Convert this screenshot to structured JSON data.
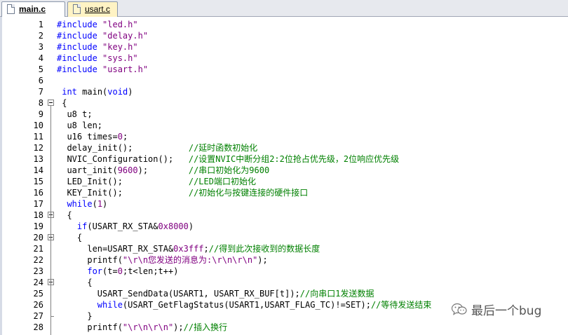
{
  "tabs": [
    {
      "label": "main.c",
      "active": true
    },
    {
      "label": "usart.c",
      "active": false
    }
  ],
  "lines": [
    {
      "n": "1",
      "tokens": [
        {
          "t": "#include ",
          "c": "kw"
        },
        {
          "t": "\"led.h\"",
          "c": "str"
        }
      ]
    },
    {
      "n": "2",
      "tokens": [
        {
          "t": "#include ",
          "c": "kw"
        },
        {
          "t": "\"delay.h\"",
          "c": "str"
        }
      ]
    },
    {
      "n": "3",
      "tokens": [
        {
          "t": "#include ",
          "c": "kw"
        },
        {
          "t": "\"key.h\"",
          "c": "str"
        }
      ]
    },
    {
      "n": "4",
      "tokens": [
        {
          "t": "#include ",
          "c": "kw"
        },
        {
          "t": "\"sys.h\"",
          "c": "str"
        }
      ]
    },
    {
      "n": "5",
      "tokens": [
        {
          "t": "#include ",
          "c": "kw"
        },
        {
          "t": "\"usart.h\"",
          "c": "str"
        }
      ]
    },
    {
      "n": "6",
      "tokens": []
    },
    {
      "n": "7",
      "tokens": [
        {
          "t": " "
        },
        {
          "t": "int",
          "c": "kw"
        },
        {
          "t": " main("
        },
        {
          "t": "void",
          "c": "kw"
        },
        {
          "t": ")"
        }
      ]
    },
    {
      "n": "8",
      "fold": "open",
      "tokens": [
        {
          "t": " {"
        }
      ]
    },
    {
      "n": "9",
      "tokens": [
        {
          "t": "  u8 t;"
        }
      ]
    },
    {
      "n": "10",
      "tokens": [
        {
          "t": "  u8 len;"
        }
      ]
    },
    {
      "n": "11",
      "tokens": [
        {
          "t": "  u16 times="
        },
        {
          "t": "0",
          "c": "num"
        },
        {
          "t": ";"
        }
      ]
    },
    {
      "n": "12",
      "tokens": [
        {
          "t": "  delay_init();           "
        },
        {
          "t": "//延时函数初始化",
          "c": "cm"
        }
      ]
    },
    {
      "n": "13",
      "tokens": [
        {
          "t": "  NVIC_Configuration();   "
        },
        {
          "t": "//设置NVIC中断分组2:2位抢占优先级，2位响应优先级",
          "c": "cm"
        }
      ]
    },
    {
      "n": "14",
      "tokens": [
        {
          "t": "  uart_init("
        },
        {
          "t": "9600",
          "c": "num"
        },
        {
          "t": ");        "
        },
        {
          "t": "//串口初始化为9600",
          "c": "cm"
        }
      ]
    },
    {
      "n": "15",
      "tokens": [
        {
          "t": "  LED_Init();             "
        },
        {
          "t": "//LED端口初始化",
          "c": "cm"
        }
      ]
    },
    {
      "n": "16",
      "tokens": [
        {
          "t": "  KEY_Init();             "
        },
        {
          "t": "//初始化与按键连接的硬件接口",
          "c": "cm"
        }
      ]
    },
    {
      "n": "17",
      "tokens": [
        {
          "t": "  "
        },
        {
          "t": "while",
          "c": "kw"
        },
        {
          "t": "("
        },
        {
          "t": "1",
          "c": "num"
        },
        {
          "t": ")"
        }
      ]
    },
    {
      "n": "18",
      "fold": "open",
      "tokens": [
        {
          "t": "  {"
        }
      ]
    },
    {
      "n": "19",
      "tokens": [
        {
          "t": "    "
        },
        {
          "t": "if",
          "c": "kw"
        },
        {
          "t": "(USART_RX_STA&"
        },
        {
          "t": "0x8000",
          "c": "num"
        },
        {
          "t": ")"
        }
      ]
    },
    {
      "n": "20",
      "fold": "open",
      "tokens": [
        {
          "t": "    {"
        }
      ]
    },
    {
      "n": "21",
      "tokens": [
        {
          "t": "      len=USART_RX_STA&"
        },
        {
          "t": "0x3fff",
          "c": "num"
        },
        {
          "t": ";"
        },
        {
          "t": "//得到此次接收到的数据长度",
          "c": "cm"
        }
      ]
    },
    {
      "n": "22",
      "tokens": [
        {
          "t": "      printf("
        },
        {
          "t": "\"\\r\\n您发送的消息为:\\r\\n\\r\\n\"",
          "c": "str"
        },
        {
          "t": ");"
        }
      ]
    },
    {
      "n": "23",
      "tokens": [
        {
          "t": "      "
        },
        {
          "t": "for",
          "c": "kw"
        },
        {
          "t": "(t="
        },
        {
          "t": "0",
          "c": "num"
        },
        {
          "t": ";t<len;t++)"
        }
      ]
    },
    {
      "n": "24",
      "fold": "open",
      "tokens": [
        {
          "t": "      {"
        }
      ]
    },
    {
      "n": "25",
      "tokens": [
        {
          "t": "        USART_SendData(USART1, USART_RX_BUF[t]);"
        },
        {
          "t": "//向串口1发送数据",
          "c": "cm"
        }
      ]
    },
    {
      "n": "26",
      "tokens": [
        {
          "t": "        "
        },
        {
          "t": "while",
          "c": "kw"
        },
        {
          "t": "(USART_GetFlagStatus(USART1,USART_FLAG_TC)!=SET);"
        },
        {
          "t": "//等待发送结束",
          "c": "cm"
        }
      ]
    },
    {
      "n": "27",
      "fold": "end",
      "tokens": [
        {
          "t": "      }"
        }
      ]
    },
    {
      "n": "28",
      "tokens": [
        {
          "t": "      printf("
        },
        {
          "t": "\"\\r\\n\\r\\n\"",
          "c": "str"
        },
        {
          "t": ");"
        },
        {
          "t": "//插入换行",
          "c": "cm"
        }
      ]
    }
  ],
  "watermark": {
    "text": "最后一个bug"
  }
}
